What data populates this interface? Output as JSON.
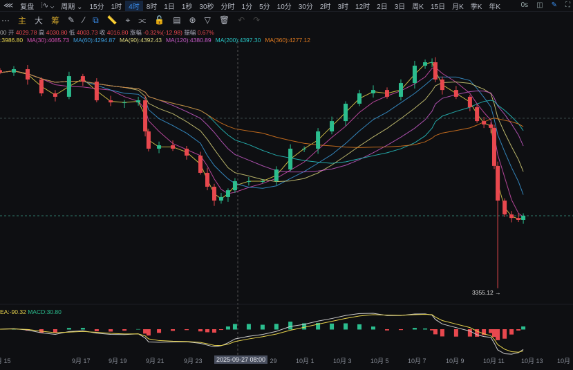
{
  "toolbar": {
    "back": "⋘",
    "title": "复盘",
    "indicator_menu": "⫶∿ ⌄",
    "period_menu": "周期 ⌄",
    "periods": [
      "15分",
      "1时",
      "4时",
      "8时",
      "1日",
      "1秒",
      "30秒",
      "分时",
      "1分",
      "5分",
      "10分",
      "30分",
      "2时",
      "3时",
      "12时",
      "2日",
      "3日",
      "周K",
      "15日",
      "月K",
      "季K",
      "年K"
    ],
    "active_period": "4时",
    "delay": "0s"
  },
  "tools": {
    "more": "···",
    "main": "主",
    "big": "大",
    "chip": "筹"
  },
  "ohlc": {
    "prefix": "00",
    "open_label": "开",
    "open": "4029.78",
    "high_label": "高",
    "high": "4030.80",
    "low_label": "低",
    "low": "4003.73",
    "close_label": "收",
    "close": "4016.80",
    "chg_label": "涨幅",
    "chg": "-0.32%(-12.98)",
    "amp_label": "振幅",
    "amp": "0.67%"
  },
  "ma": [
    {
      "t": ":3986.80",
      "c": "#e8d44d"
    },
    {
      "t": "MA(30):4085.73",
      "c": "#d24fb0"
    },
    {
      "t": "MA(60):4294.87",
      "c": "#3a9ad9"
    },
    {
      "t": "MA(90):4392.43",
      "c": "#d8d27a"
    },
    {
      "t": "MA(120):4380.89",
      "c": "#c55ac7"
    },
    {
      "t": "MA(200):4397.30",
      "c": "#28c6c6"
    },
    {
      "t": "MA(360):4277.12",
      "c": "#e07a20"
    }
  ],
  "macd": {
    "dea": "EA:-90.32",
    "macd": "MACD:30.80"
  },
  "low_marker": "3355.12 →",
  "crosshair_time": "2025-09-27 08:00",
  "x_labels": [
    "月 15",
    "9月 17",
    "9月 19",
    "9月 21",
    "9月 23",
    "9月 25",
    "9月 29",
    "10月 1",
    "10月 3",
    "10月 5",
    "10月 7",
    "10月 9",
    "10月 11",
    "10月 13",
    "10月"
  ],
  "colors": {
    "up": "#2bbd8e",
    "down": "#e8484e"
  },
  "chart_data": {
    "type": "candlestick",
    "low_extreme": 3355.12,
    "last": 4016.8,
    "t": [
      -0.37,
      0.37,
      1.11,
      1.85,
      2.59,
      3.33,
      4.07,
      4.81,
      5.56,
      6.3,
      7.04,
      7.41,
      7.59,
      8.15,
      8.89,
      9.63,
      10.37,
      10.74,
      11.11,
      11.48,
      11.85,
      12.22,
      12.96,
      13.7,
      14.44,
      15.19,
      15.93,
      16.67,
      17.41,
      18.15,
      18.89,
      19.63,
      20.37,
      21.11,
      21.85,
      22.41,
      22.78,
      22.96,
      23.33,
      24.07,
      24.81,
      25.19,
      25.56,
      25.93,
      26.11,
      26.3,
      26.67,
      27.04,
      27.41,
      27.67
    ],
    "close": [
      4693,
      4714,
      4650,
      4564,
      4543,
      4671,
      4637,
      4521,
      4508,
      4508,
      4521,
      4328,
      4221,
      4242,
      4221,
      4178,
      4071,
      3985,
      3899,
      3921,
      3963,
      4019,
      4019,
      4019,
      4092,
      4221,
      4221,
      4328,
      4392,
      4500,
      4564,
      4585,
      4543,
      4628,
      4736,
      4757,
      4757,
      4650,
      4585,
      4543,
      4478,
      4392,
      4371,
      4350,
      4114,
      3899,
      3813,
      3791,
      3779,
      3805
    ]
  }
}
